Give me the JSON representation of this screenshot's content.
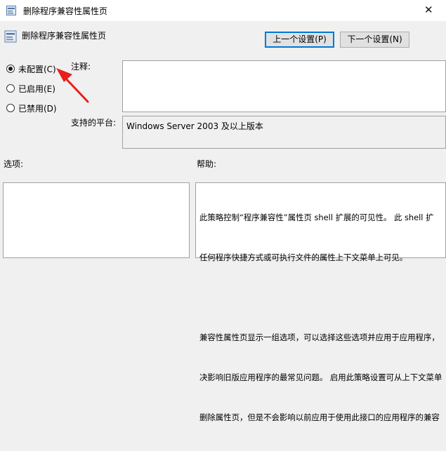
{
  "window": {
    "title": "删除程序兼容性属性页"
  },
  "header": {
    "policy_name": "删除程序兼容性属性页"
  },
  "nav": {
    "prev_label": "上一个设置(P)",
    "next_label": "下一个设置(N)"
  },
  "radios": [
    {
      "label": "未配置(C)",
      "checked": true
    },
    {
      "label": "已启用(E)",
      "checked": false
    },
    {
      "label": "已禁用(D)",
      "checked": false
    }
  ],
  "comment": {
    "label": "注释:",
    "value": ""
  },
  "platform": {
    "label": "支持的平台:",
    "value": "Windows Server 2003 及以上版本"
  },
  "options": {
    "label": "选项:"
  },
  "help": {
    "label": "帮助:",
    "lines": [
      "此策略控制“程序兼容性”属性页 shell 扩展的可见性。 此 shell 扩",
      "任何程序快捷方式或可执行文件的属性上下文菜单上可见。",
      "",
      "兼容性属性页显示一组选项，可以选择这些选项并应用于应用程序，",
      "决影响旧版应用程序的最常见问题。 启用此策略设置可从上下文菜单",
      "删除属性页，但是不会影响以前应用于使用此接口的应用程序的兼容"
    ]
  },
  "annotation": {
    "color": "#e8201c"
  }
}
